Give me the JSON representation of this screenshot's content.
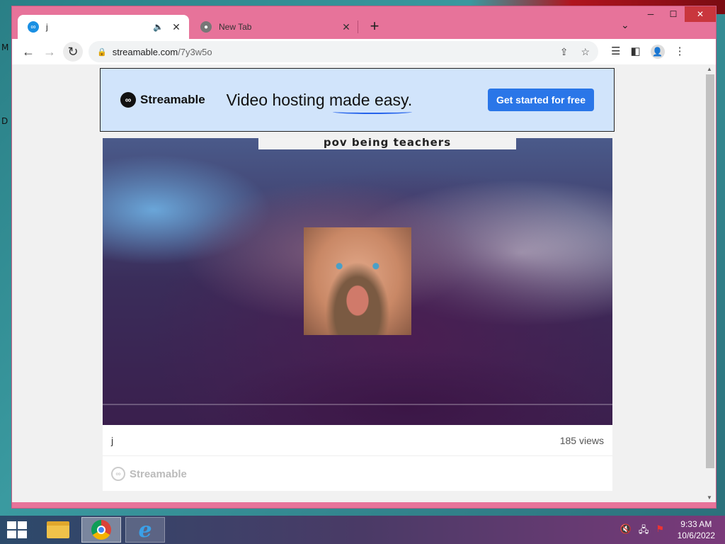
{
  "desktop": {
    "letters": [
      "M",
      "D"
    ]
  },
  "tabs": [
    {
      "title": "j",
      "active": true,
      "favicon": "streamable-icon",
      "audio_icon": "speaker-icon"
    },
    {
      "title": "New Tab",
      "active": false,
      "favicon": "chrome-icon"
    }
  ],
  "toolbar": {
    "url_host": "streamable.com",
    "url_path": "/7y3w5o"
  },
  "banner": {
    "brand": "Streamable",
    "tagline": "Video hosting made easy.",
    "cta": "Get started for free"
  },
  "video": {
    "caption": "pov being teachers",
    "title": "j",
    "views": "185 views",
    "footer_brand": "Streamable"
  },
  "taskbar": {
    "apps": [
      "file-explorer",
      "chrome",
      "internet-explorer"
    ],
    "time": "9:33 AM",
    "date": "10/6/2022"
  },
  "colors": {
    "window_frame": "#e7739a",
    "banner_bg": "#d1e4fb",
    "cta_bg": "#2a76e8"
  }
}
